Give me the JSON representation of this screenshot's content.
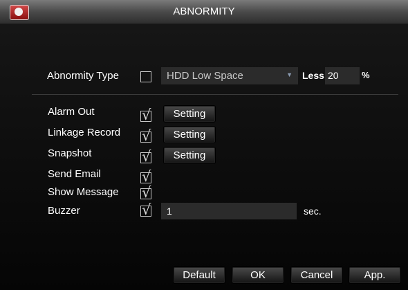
{
  "title": "ABNORMITY",
  "abnormity": {
    "type_label": "Abnormity Type",
    "type_value": "HDD Low Space",
    "less_label": "Less",
    "less_value": "20",
    "percent_label": "%"
  },
  "rows": {
    "alarm_out": {
      "label": "Alarm Out",
      "setting": "Setting"
    },
    "linkage_record": {
      "label": "Linkage Record",
      "setting": "Setting"
    },
    "snapshot": {
      "label": "Snapshot",
      "setting": "Setting"
    },
    "send_email": {
      "label": "Send Email"
    },
    "show_message": {
      "label": "Show Message"
    },
    "buzzer": {
      "label": "Buzzer",
      "value": "1",
      "unit": "sec."
    }
  },
  "buttons": {
    "default": "Default",
    "ok": "OK",
    "cancel": "Cancel",
    "apply": "App."
  }
}
